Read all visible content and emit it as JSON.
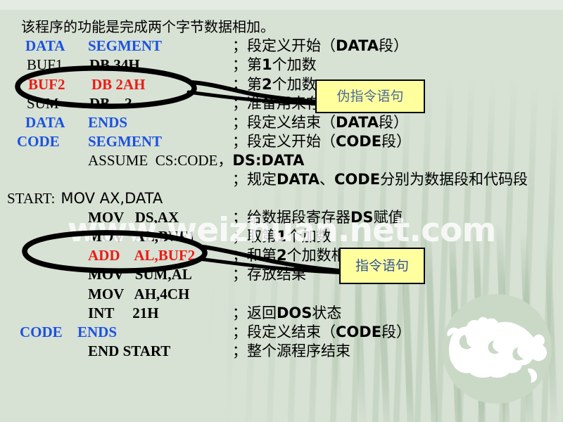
{
  "slide": {
    "background_color": "#d7e1d4",
    "title": "该程序的功能是完成两个字节数据相加。",
    "watermark": "www.weizhuan.net.com"
  },
  "code": {
    "lines": [
      {
        "label": "DATA",
        "op": "SEGMENT",
        "color": "#1b52e0",
        "comment": "；段定义开始（DATA段）"
      },
      {
        "label": "BUF1",
        "op": "DB 34H",
        "color": "#000000",
        "comment": "；第1个加数"
      },
      {
        "label": "BUF2",
        "op": "DB 2AH",
        "color": "#ec1c16",
        "comment": "；第2个加数"
      },
      {
        "label": "SUM",
        "op": "DB   ?",
        "color": "#000000",
        "comment": "；准备用来存放结果"
      },
      {
        "label": "DATA",
        "op": "ENDS",
        "color": "#1b52e0",
        "comment": "；段定义结束（DATA段）"
      },
      {
        "label": "CODE",
        "op": "SEGMENT",
        "color": "#1b52e0",
        "comment": "；段定义开始（CODE段）"
      },
      {
        "label": "",
        "op": "ASSUME  CS:CODE，DS:DATA",
        "color": "#000000",
        "comment": ""
      },
      {
        "label": "",
        "op": "",
        "color": "#000000",
        "comment": "；规定DATA、CODE分别为数据段和代码段"
      },
      {
        "label": "START:",
        "op": "MOV AX,DATA",
        "color": "#000000",
        "comment": ""
      },
      {
        "label": "",
        "op": "MOV   DS,AX",
        "color": "#000000",
        "comment": "；给数据段寄存器DS赋值"
      },
      {
        "label": "",
        "op": "MOV   AL,BUF1",
        "color": "#000000",
        "comment": "；取第1个加数"
      },
      {
        "label": "",
        "op": "ADD    AL,BUF2",
        "color": "#ec1c16",
        "comment": "；和第2个加数相加"
      },
      {
        "label": "",
        "op": "MOV   SUM,AL",
        "color": "#000000",
        "comment": "；存放结果"
      },
      {
        "label": "",
        "op": "MOV   AH,4CH",
        "color": "#000000",
        "comment": ""
      },
      {
        "label": "",
        "op": "INT     21H",
        "color": "#000000",
        "comment": "；返回DOS状态"
      },
      {
        "label": "CODE",
        "op": "ENDS",
        "color": "#1b52e0",
        "comment": "；段定义结束（CODE段）"
      },
      {
        "label": "",
        "op": "END START",
        "color": "#000000",
        "comment": "；整个源程序结束"
      }
    ],
    "line_texts": {
      "l1_label": "DATA",
      "l1_op": "SEGMENT",
      "l2_label": "BUF1",
      "l2_op": "DB 34H",
      "l3_label": "BUF2",
      "l3_op": "DB 2AH",
      "l4_label": "SUM",
      "l4_op": "DB    ?",
      "l5_label": "DATA",
      "l5_op": "ENDS",
      "l6_label": "CODE",
      "l6_op": "SEGMENT",
      "l7_op": "ASSUME  CS:CODE，",
      "l7_op_b": "DS:DATA",
      "l9_label": "START:",
      "l9_op": "MOV AX,DATA",
      "l10_op": "MOV   DS,AX",
      "l11_op": "MOV   AL,BUF1",
      "l12_op": "ADD    AL,BUF2",
      "l13_op": "MOV   SUM,AL",
      "l14_op": "MOV   AH,4CH",
      "l15_op": "INT     21H",
      "l16_label": "CODE",
      "l16_op": "ENDS",
      "l17_op": "END START"
    },
    "comments": {
      "c1_a": "；段定义开始（",
      "c1_b": "DATA",
      "c1_c": "段）",
      "c2_a": "；第",
      "c2_b": "1",
      "c2_c": "个加数",
      "c3_a": "；第",
      "c3_b": "2",
      "c3_c": "个加数",
      "c4_a": "；准备用来存放结果",
      "c5_a": "；段定义结束（",
      "c5_b": "DATA",
      "c5_c": "段）",
      "c6_a": "；段定义开始（",
      "c6_b": "CODE",
      "c6_c": "段）",
      "c8_a": "；规定",
      "c8_b": "DATA",
      "c8_c": "、",
      "c8_d": "CODE",
      "c8_e": "分别为数据段和代码段",
      "c10_a": "；给数据段寄存器",
      "c10_b": "DS",
      "c10_c": "赋值",
      "c11_a": "；取第",
      "c11_b": "1",
      "c11_c": "个加数",
      "c12_a": "；和第",
      "c12_b": "2",
      "c12_c": "个加数相加",
      "c13_a": "；存放结果",
      "c15_a": "；返回",
      "c15_b": "DOS",
      "c15_c": "状态",
      "c16_a": "；段定义结束（",
      "c16_b": "CODE",
      "c16_c": "段）",
      "c17_a": "；整个源程序结束"
    }
  },
  "annotations": {
    "pseudo_instruction_label": "伪指令语句",
    "instruction_label": "指令语句",
    "pseudo_target": "BUF2    DB 2AH",
    "instruction_target": "ADD    AL,BUF2",
    "ink_color": "#000000",
    "callout_fill": "#ffff9e",
    "callout_text_color": "#4a6a96"
  }
}
